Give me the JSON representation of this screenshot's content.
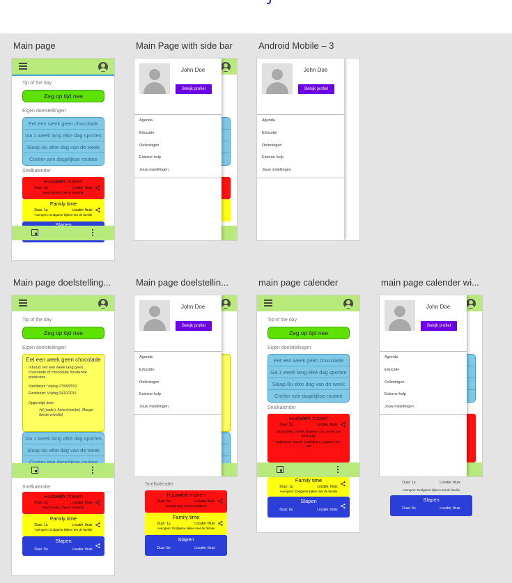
{
  "boards": [
    {
      "key": "b1",
      "title": "Main page"
    },
    {
      "key": "b2",
      "title": "Main Page with side bar"
    },
    {
      "key": "b3",
      "title": "Android Mobile – 3"
    },
    {
      "key": "b4",
      "title": "Main page doelstelling..."
    },
    {
      "key": "b5",
      "title": "Main page doelstellin..."
    },
    {
      "key": "b6",
      "title": "main page calender"
    },
    {
      "key": "b7",
      "title": "main page calender wi..."
    }
  ],
  "labels": {
    "tip": "Tip of the day",
    "tip_text": "Zeg op tijd nee",
    "goals": "Eigen doelstellingen",
    "calendar": "Snelkalender"
  },
  "goals": [
    "Eet een week geen chocolade",
    "Ga 1 week lang elke dag sporten",
    "Slaap 8u elke dag van de week",
    "Creëer een dagelijkse routine"
  ],
  "events": {
    "huiswerk": {
      "title": "Huiswerk maken",
      "duur": "Duur: 8u",
      "locatie": "Locatie: thuis",
      "desc": "Beschrijving: cherrie studeren"
    },
    "huiswerk_long": {
      "duur": "Duur: 8u",
      "locatie": "Locatie: thuis",
      "desc": "Beschrijving: cherrie studeren voor de test van donderdag",
      "desc2": "Organische chemie: hoofdstuk 6, pagina's 140 - 160"
    },
    "family": {
      "title": "Family time",
      "duur": "Duur: 1u",
      "locatie": "Locatie: thuis",
      "desc": "Avengers: Endgame kijken met de familie"
    },
    "slapen": {
      "title": "Slapen",
      "duur": "Duur: 8u",
      "locatie": "Locatie: thuis"
    }
  },
  "goal_detail": {
    "title": "Eet een week geen chocolade",
    "inhoud": "Inhoud: eet een week lang geen chocolade of chocolade houdende producten",
    "start": "Startdatum: Vrijdag 27/09/2019",
    "end": "Einddatum: Vrijdag 04/10/2019",
    "opgevolgd": "Opgevolgd door:",
    "people": "Jef (vader), Anita (moeder), Margot (beste vriendin)"
  },
  "drawer": {
    "name": "John Doe",
    "profile_button": "Bekijk profiel",
    "items": [
      "Agenda",
      "Educatie",
      "Oefeningen",
      "Externe hulp",
      "Jouw instellingen"
    ]
  },
  "colors": {
    "appbar": "#b7ea7a",
    "tip": "#5de200",
    "goals": "#7fc8e6",
    "red": "#ff1010",
    "yellow": "#ffff10",
    "blue": "#2b3ed8",
    "profile": "#6b00e6"
  }
}
